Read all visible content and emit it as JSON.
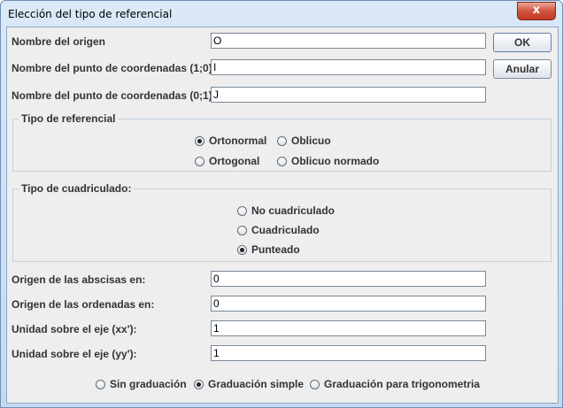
{
  "window": {
    "title": "Elección del tipo de referencial",
    "close_label": "x"
  },
  "fields": {
    "origen": {
      "label": "Nombre del origen",
      "value": "O"
    },
    "punto10": {
      "label": "Nombre del punto de coordenadas (1;0):",
      "value": "I"
    },
    "punto01": {
      "label": "Nombre del punto de coordenadas (0;1):",
      "value": "J"
    },
    "orig_abscisas": {
      "label": "Origen de las abscisas en:",
      "value": "0"
    },
    "orig_ordenadas": {
      "label": "Origen de las ordenadas en:",
      "value": "0"
    },
    "unidad_xx": {
      "label": "Unidad sobre el eje (xx'):",
      "value": "1"
    },
    "unidad_yy": {
      "label": "Unidad sobre el eje (yy'):",
      "value": "1"
    }
  },
  "buttons": {
    "ok": "OK",
    "anular": "Anular"
  },
  "tipo_referencial": {
    "legend": "Tipo de referencial",
    "options": [
      "Ortonormal",
      "Oblicuo",
      "Ortogonal",
      "Oblicuo normado"
    ],
    "selected": "Ortonormal"
  },
  "tipo_cuadriculado": {
    "legend": "Tipo de cuadriculado:",
    "options": [
      "No cuadriculado",
      "Cuadriculado",
      "Punteado"
    ],
    "selected": "Punteado"
  },
  "graduacion": {
    "options": [
      "Sin graduación",
      "Graduación simple",
      "Graduación para trigonometria"
    ],
    "selected": "Graduación simple"
  }
}
